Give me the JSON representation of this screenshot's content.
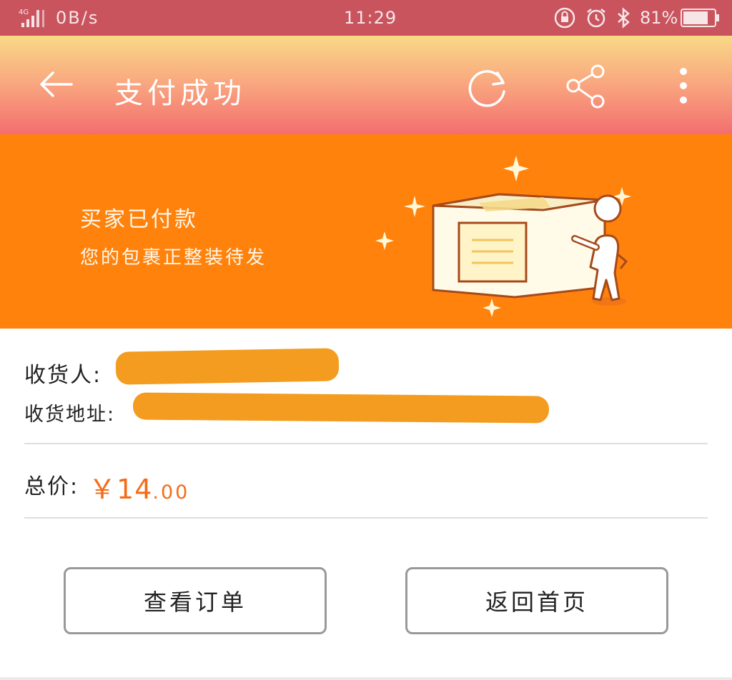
{
  "status_bar": {
    "network": "4G",
    "speed": "0B/s",
    "time": "11:29",
    "battery": "81%",
    "battery_level": 0.81
  },
  "app_bar": {
    "title": "支付成功",
    "icons": [
      "back-arrow-icon",
      "refresh-icon",
      "share-icon",
      "more-vertical-icon"
    ]
  },
  "banner": {
    "line1": "买家已付款",
    "line2": "您的包裹正整装待发"
  },
  "order": {
    "recipient_label": "收货人:",
    "address_label": "收货地址:",
    "total_label": "总价:",
    "total_currency": "￥",
    "total_integer": "14",
    "total_decimal": ".00"
  },
  "actions": {
    "view_order": "查看订单",
    "back_home": "返回首页"
  },
  "colors": {
    "status_bar": "#c9545e",
    "banner": "#ff820d",
    "price": "#f36d19",
    "redaction": "#f39c1f"
  }
}
